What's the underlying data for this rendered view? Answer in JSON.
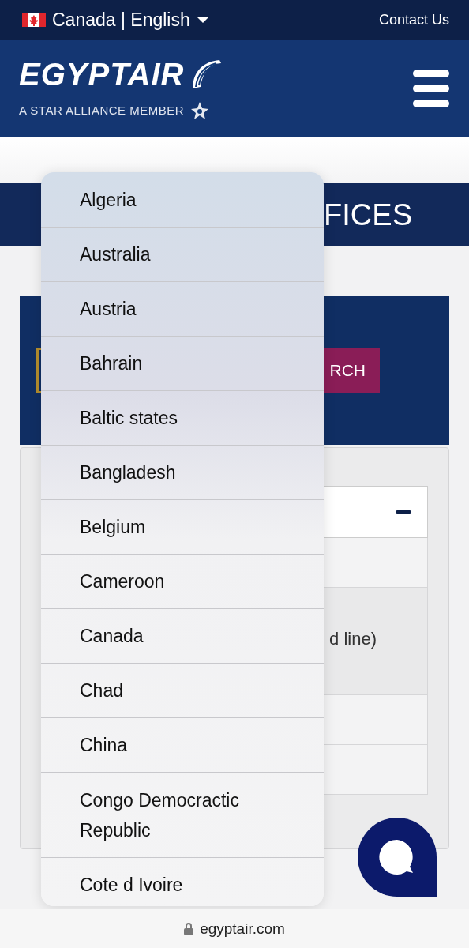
{
  "top_bar": {
    "locale": "Canada | English",
    "contact": "Contact Us"
  },
  "header": {
    "logo_text": "EGYPTAIR",
    "tagline": "A STAR ALLIANCE MEMBER"
  },
  "banner": {
    "title_right": "FICES"
  },
  "search_card": {
    "button": "RCH"
  },
  "results": {
    "rows": [
      {
        "kind": "select"
      },
      {
        "kind": "row"
      },
      {
        "kind": "row",
        "text": "d line)"
      },
      {
        "kind": "row"
      },
      {
        "kind": "row"
      }
    ]
  },
  "dropdown": {
    "options": [
      {
        "label": "Algeria"
      },
      {
        "label": "Australia"
      },
      {
        "label": "Austria"
      },
      {
        "label": "Bahrain"
      },
      {
        "label": "Baltic states"
      },
      {
        "label": "Bangladesh"
      },
      {
        "label": "Belgium"
      },
      {
        "label": "Cameroon"
      },
      {
        "label": "Canada"
      },
      {
        "label": "Chad"
      },
      {
        "label": "China"
      },
      {
        "label": "Congo Democractic Republic"
      },
      {
        "label": "Cote d Ivoire"
      }
    ]
  },
  "address_bar": {
    "url": "egyptair.com"
  }
}
